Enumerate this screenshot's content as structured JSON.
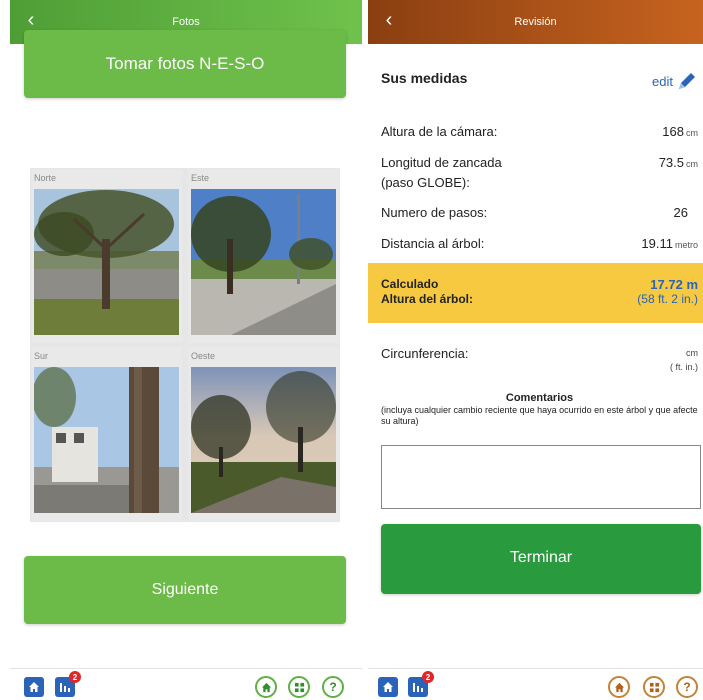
{
  "left": {
    "title": "Fotos",
    "back_icon": "chevron-left-icon",
    "take_photos_label": "Tomar fotos N-E-S-O",
    "photos": [
      {
        "label": "Norte"
      },
      {
        "label": "Este"
      },
      {
        "label": "Sur"
      },
      {
        "label": "Oeste"
      }
    ],
    "next_label": "Siguiente",
    "badge_count": "2",
    "help_label": "?"
  },
  "right": {
    "title": "Revisión",
    "back_icon": "chevron-left-icon",
    "section_title": "Sus medidas",
    "edit_label": "edit",
    "rows": {
      "camera_height": {
        "label": "Altura de la cámara:",
        "value": "168",
        "unit": "cm"
      },
      "stride_length": {
        "label": "Longitud de zancada",
        "label2": "(paso GLOBE):",
        "value": "73.5",
        "unit": "cm"
      },
      "steps": {
        "label": "Numero de pasos:",
        "value": "26"
      },
      "distance": {
        "label": "Distancia al árbol:",
        "value": "19.11",
        "unit": "metro"
      }
    },
    "calculated": {
      "line1": "Calculado",
      "line2": "Altura del árbol:",
      "value_m": "17.72 m",
      "value_ft": "(58 ft. 2 in.)"
    },
    "circumference": {
      "label": "Circunferencia:",
      "unit": "cm",
      "unit2": "( ft. in.)"
    },
    "comments": {
      "title": "Comentarios",
      "note": "(incluya cualquier cambio reciente que haya ocurrido en este árbol y que afecte su altura)",
      "value": ""
    },
    "finish_label": "Terminar",
    "badge_count": "2",
    "help_label": "?"
  },
  "colors": {
    "left_header": "#5aa83d",
    "right_header": "#a94e18",
    "green_button": "#6cba47",
    "finish_button": "#2a9a3f",
    "highlight": "#f7c941",
    "link_blue": "#2a63b8"
  }
}
